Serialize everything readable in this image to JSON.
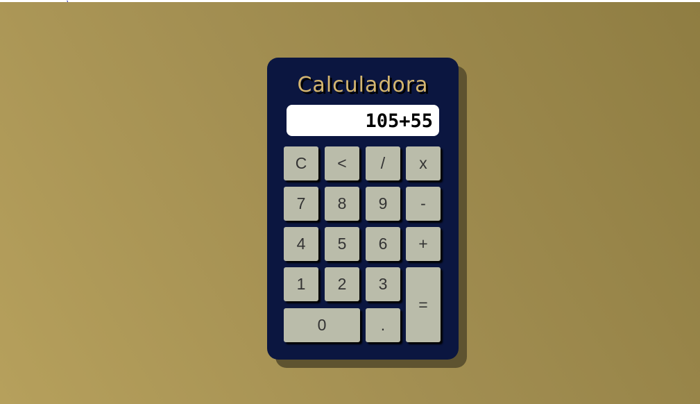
{
  "calculator": {
    "title": "Calculadora",
    "display_value": "105+55",
    "colors": {
      "background_light": "#b6a05c",
      "background_dark": "#8f7d42",
      "body": "#0b1640",
      "title": "#d4b670",
      "key": "#babcaa",
      "display": "#ffffff"
    },
    "keys": {
      "clear": "C",
      "backspace": "<",
      "divide": "/",
      "multiply": "x",
      "seven": "7",
      "eight": "8",
      "nine": "9",
      "minus": "-",
      "four": "4",
      "five": "5",
      "six": "6",
      "plus": "+",
      "one": "1",
      "two": "2",
      "three": "3",
      "equals": "=",
      "zero": "0",
      "decimal": "."
    }
  }
}
